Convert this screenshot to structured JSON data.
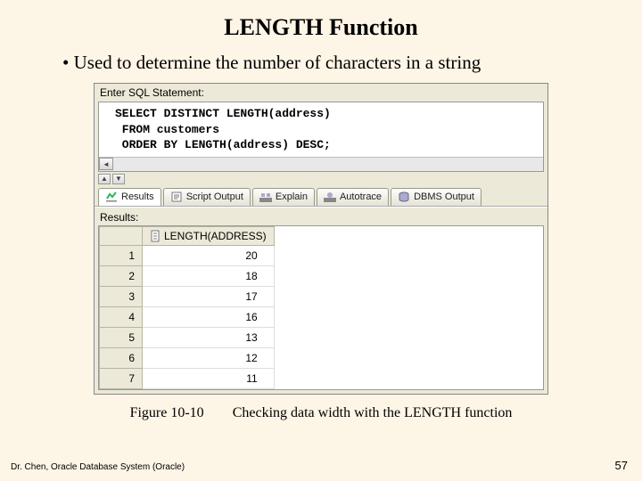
{
  "slide": {
    "title": "LENGTH Function",
    "bullet": "Used to determine the number of characters in a string",
    "caption_num": "Figure 10-10",
    "caption_text": "Checking data width with the LENGTH function",
    "footer_left": "Dr. Chen, Oracle Database System (Oracle)",
    "page_number": "57"
  },
  "sql_window": {
    "enter_label": "Enter SQL Statement:",
    "code_line1": "SELECT DISTINCT LENGTH(address)",
    "code_line2": " FROM customers",
    "code_line3": " ORDER BY LENGTH(address) DESC;",
    "tabs": {
      "results": "Results",
      "script": "Script Output",
      "explain": "Explain",
      "autotrace": "Autotrace",
      "dbms": "DBMS Output"
    },
    "results_label": "Results:",
    "column_header": "LENGTH(ADDRESS)",
    "rows": [
      {
        "n": "1",
        "v": "20"
      },
      {
        "n": "2",
        "v": "18"
      },
      {
        "n": "3",
        "v": "17"
      },
      {
        "n": "4",
        "v": "16"
      },
      {
        "n": "5",
        "v": "13"
      },
      {
        "n": "6",
        "v": "12"
      },
      {
        "n": "7",
        "v": "11"
      }
    ]
  }
}
